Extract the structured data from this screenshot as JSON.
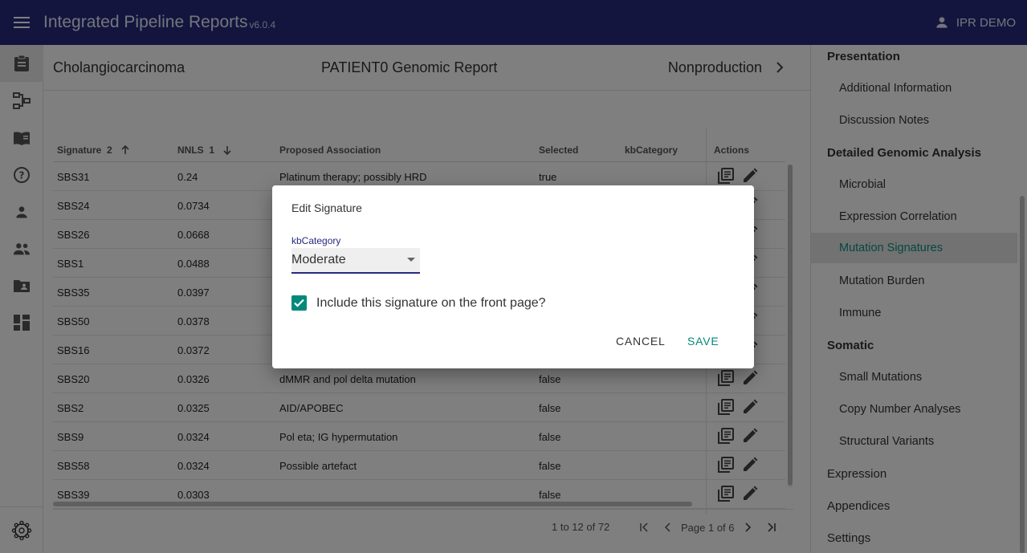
{
  "app": {
    "title": "Integrated Pipeline Reports",
    "version": "v6.0.4",
    "user": "IPR DEMO"
  },
  "left_nav": {
    "icons": [
      "report-icon",
      "pipeline-icon",
      "book-icon",
      "help-icon",
      "person-icon",
      "people-icon",
      "folder-person-icon",
      "dashboard-icon"
    ],
    "bottom_icon": "settings-gear-icon"
  },
  "report_header": {
    "left": "Cholangiocarcinoma",
    "center": "PATIENT0 Genomic Report",
    "right": "Nonproduction"
  },
  "table": {
    "columns": {
      "signature": "Signature",
      "signature_sort": "2",
      "nnls": "NNLS",
      "nnls_sort": "1",
      "proposed": "Proposed Association",
      "selected": "Selected",
      "kbcategory": "kbCategory",
      "actions": "Actions"
    },
    "rows": [
      {
        "signature": "SBS31",
        "nnls": "0.24",
        "proposed": "Platinum therapy; possibly HRD",
        "selected": "true"
      },
      {
        "signature": "SBS24",
        "nnls": "0.0734",
        "proposed": "",
        "selected": ""
      },
      {
        "signature": "SBS26",
        "nnls": "0.0668",
        "proposed": "",
        "selected": ""
      },
      {
        "signature": "SBS1",
        "nnls": "0.0488",
        "proposed": "",
        "selected": ""
      },
      {
        "signature": "SBS35",
        "nnls": "0.0397",
        "proposed": "",
        "selected": ""
      },
      {
        "signature": "SBS50",
        "nnls": "0.0378",
        "proposed": "",
        "selected": ""
      },
      {
        "signature": "SBS16",
        "nnls": "0.0372",
        "proposed": "",
        "selected": ""
      },
      {
        "signature": "SBS20",
        "nnls": "0.0326",
        "proposed": "dMMR and pol delta mutation",
        "selected": "false"
      },
      {
        "signature": "SBS2",
        "nnls": "0.0325",
        "proposed": "AID/APOBEC",
        "selected": "false"
      },
      {
        "signature": "SBS9",
        "nnls": "0.0324",
        "proposed": "Pol eta; IG hypermutation",
        "selected": "false"
      },
      {
        "signature": "SBS58",
        "nnls": "0.0324",
        "proposed": "Possible artefact",
        "selected": "false"
      },
      {
        "signature": "SBS39",
        "nnls": "0.0303",
        "proposed": "",
        "selected": "false"
      }
    ],
    "pagination": {
      "count": "1 to 12 of 72",
      "page": "Page 1 of 6"
    }
  },
  "dialog": {
    "title": "Edit Signature",
    "field_label": "kbCategory",
    "field_value": "Moderate",
    "checkbox_label": "Include this signature on the front page?",
    "checkbox_checked": true,
    "cancel": "CANCEL",
    "save": "SAVE"
  },
  "right_panel": {
    "presentation": "Presentation",
    "additional_information": "Additional Information",
    "discussion_notes": "Discussion Notes",
    "detailed_genomic_analysis": "Detailed Genomic Analysis",
    "microbial": "Microbial",
    "expression_correlation": "Expression Correlation",
    "mutation_signatures": "Mutation Signatures",
    "mutation_burden": "Mutation Burden",
    "immune": "Immune",
    "somatic": "Somatic",
    "small_mutations": "Small Mutations",
    "copy_number_analyses": "Copy Number Analyses",
    "structural_variants": "Structural Variants",
    "expression": "Expression",
    "appendices": "Appendices",
    "settings": "Settings"
  },
  "colors": {
    "appbar": "#262b7e",
    "accent": "#00897b",
    "active_link": "#0d8f87"
  }
}
